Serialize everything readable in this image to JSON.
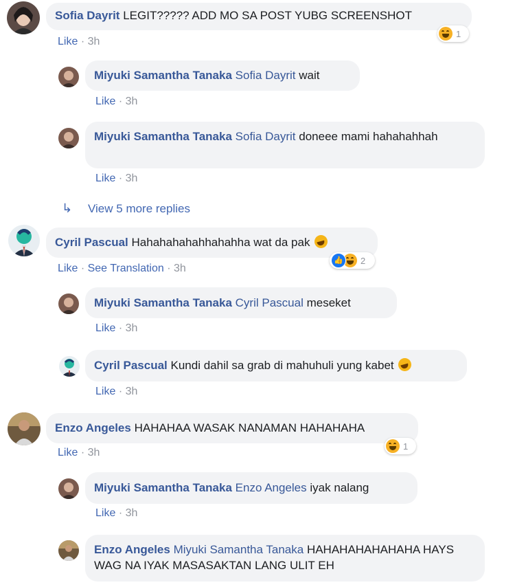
{
  "comments": [
    {
      "name": "Sofia Dayrit",
      "text": "LEGIT????? ADD MO SA POST YUBG SCREENSHOT",
      "like": "Like",
      "time": "3h",
      "reaction_count": "1"
    },
    {
      "name": "Miyuki Samantha Tanaka",
      "mention": "Sofia Dayrit",
      "text": "wait",
      "like": "Like",
      "time": "3h"
    },
    {
      "name": "Miyuki Samantha Tanaka",
      "mention": "Sofia Dayrit",
      "text": "doneee mami hahahahhah",
      "like": "Like",
      "time": "3h"
    },
    {
      "name": "Cyril Pascual",
      "text": "Hahahahahahhahahha wat da pak",
      "like": "Like",
      "see_translation": "See Translation",
      "time": "3h",
      "reaction_count": "2"
    },
    {
      "name": "Miyuki Samantha Tanaka",
      "mention": "Cyril Pascual",
      "text": "meseket",
      "like": "Like",
      "time": "3h"
    },
    {
      "name": "Cyril Pascual",
      "text": "Kundi dahil sa grab di mahuhuli yung kabet",
      "like": "Like",
      "time": "3h"
    },
    {
      "name": "Enzo Angeles",
      "text": "HAHAHAA WASAK NANAMAN HAHAHAHA",
      "like": "Like",
      "time": "3h",
      "reaction_count": "1"
    },
    {
      "name": "Miyuki Samantha Tanaka",
      "mention": "Enzo Angeles",
      "text": "iyak nalang",
      "like": "Like",
      "time": "3h"
    },
    {
      "name": "Enzo Angeles",
      "mention": "Miyuki Samantha Tanaka",
      "text": "HAHAHAHAHAHAHA HAYS WAG NA IYAK MASASAKTAN LANG ULIT EH"
    }
  ],
  "view_more": "View 5 more replies",
  "sep": "·",
  "colors": {
    "link": "#385898",
    "bubble": "#f2f3f5",
    "meta": "#90949c"
  }
}
